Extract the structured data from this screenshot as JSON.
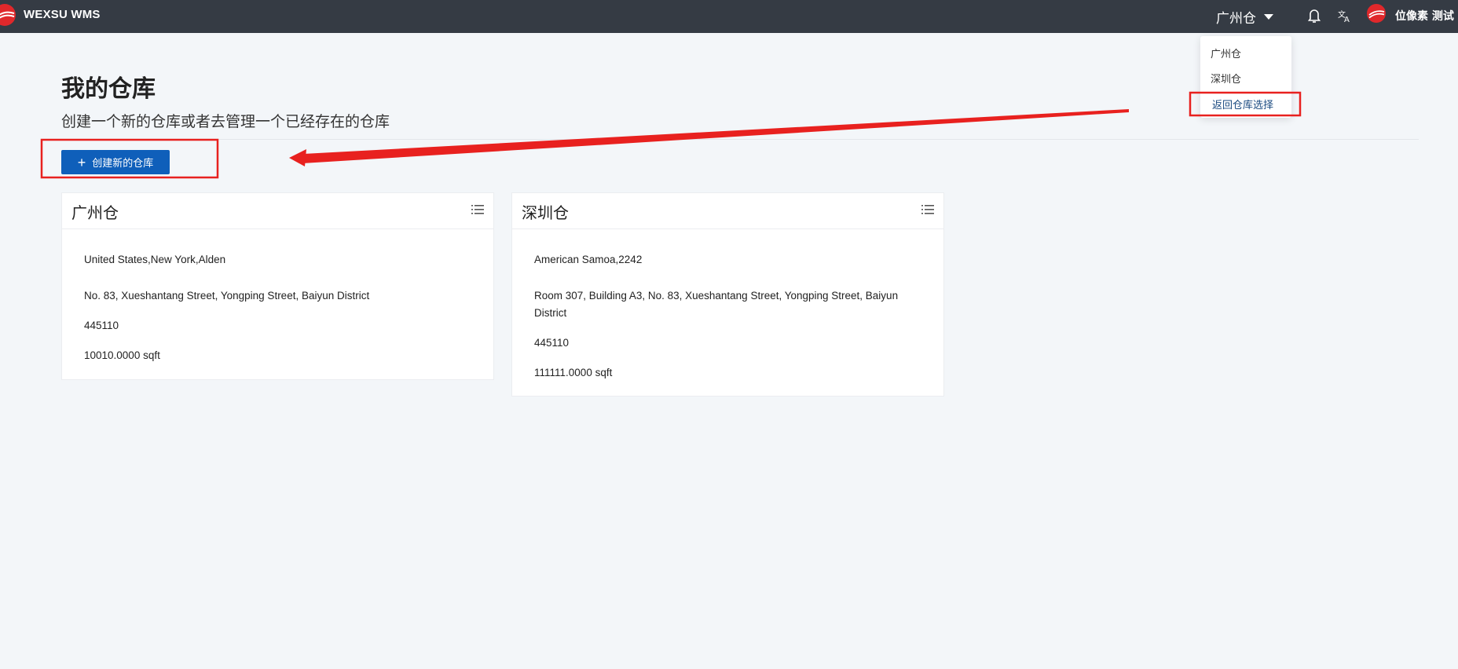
{
  "header": {
    "brand": "WEXSU WMS",
    "current_warehouse": "广州仓",
    "username": "位像素 测试",
    "icons": [
      "logo-icon",
      "caret-down-icon",
      "bell-icon",
      "translate-icon",
      "avatar-icon"
    ]
  },
  "dropdown": {
    "items": [
      "广州仓",
      "深圳仓",
      "返回仓库选择"
    ],
    "highlighted": "返回仓库选择"
  },
  "page": {
    "title": "我的仓库",
    "subtitle": "创建一个新的仓库或者去管理一个已经存在的仓库",
    "create_button": "创建新的仓库"
  },
  "warehouses": [
    {
      "name": "广州仓",
      "location": "United States,New York,Alden",
      "address": "No. 83, Xueshantang Street, Yongping Street, Baiyun District",
      "zip": "445110",
      "area": "10010.0000 sqft"
    },
    {
      "name": "深圳仓",
      "location": "American Samoa,2242",
      "address_line1": "Room 307, Building A3, No. 83, Xueshantang Street, Yongping Street, Baiyun",
      "address_line2": "District",
      "zip": "445110",
      "area": "111111.0000 sqft"
    }
  ],
  "colors": {
    "topbar": "#353b44",
    "primary": "#0f5fba",
    "annotation": "#e8211f",
    "brand_red": "#e0282b"
  }
}
